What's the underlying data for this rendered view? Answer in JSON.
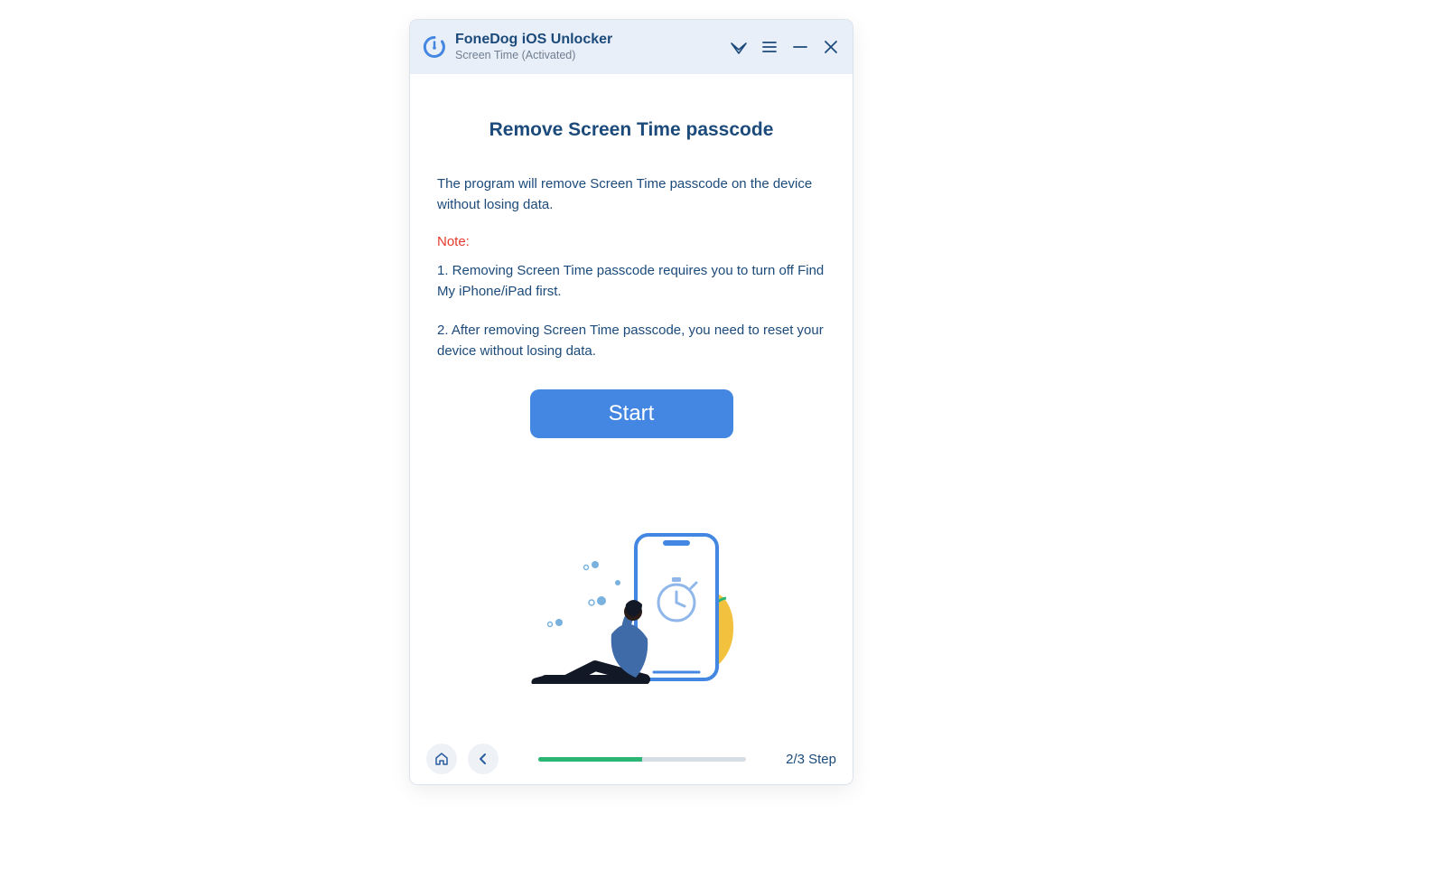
{
  "header": {
    "app_title": "FoneDog iOS Unlocker",
    "subtitle": "Screen Time  (Activated)"
  },
  "main": {
    "heading": "Remove Screen Time passcode",
    "description": "The program will remove Screen Time passcode on the device without losing data.",
    "note_label": "Note:",
    "note1": "1. Removing Screen Time passcode requires you to turn off Find My iPhone/iPad first.",
    "note2": "2. After removing Screen Time passcode, you need to reset your device without losing data.",
    "start_button_label": "Start"
  },
  "footer": {
    "step_label": "2/3 Step",
    "current_step": 2,
    "total_steps": 3,
    "progress_percent": 50
  },
  "colors": {
    "accent_blue": "#4487e2",
    "text_navy": "#1c4a7a",
    "note_red": "#e33b2e",
    "progress_green": "#2bb673",
    "titlebar_bg": "#e8eff8"
  }
}
